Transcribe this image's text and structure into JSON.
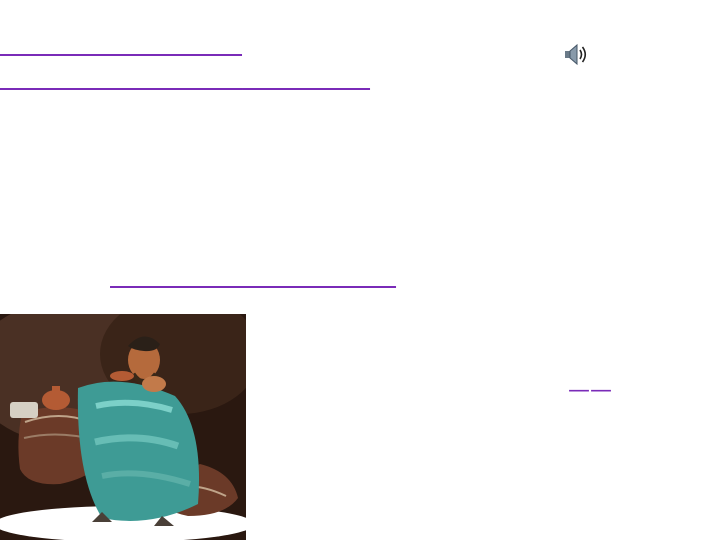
{
  "poem": {
    "line1": "　　　　　　　　　　　",
    "line2_main": "　　　　　　　　　　　",
    "line2_small": "　　　　　　　　",
    "line3": "　　　　　　",
    "line4": "　　　　　　　　　　　　　",
    "line5": "　　　　　　　　　　　　　　　　　",
    "line6": "　　　　　　　　　",
    "line7": "　　　　　　　　　　　　　　　",
    "line8_plain": "　　　　　",
    "line8_underlined": "　　　　　　　　　　　　　"
  },
  "title": {
    "main": "　　　　　　　　",
    "dash": "——",
    "author": "　　　"
  },
  "icons": {
    "speaker": "speaker-icon"
  },
  "colors": {
    "text": "#7a2bb8",
    "background": "#ffffff"
  }
}
